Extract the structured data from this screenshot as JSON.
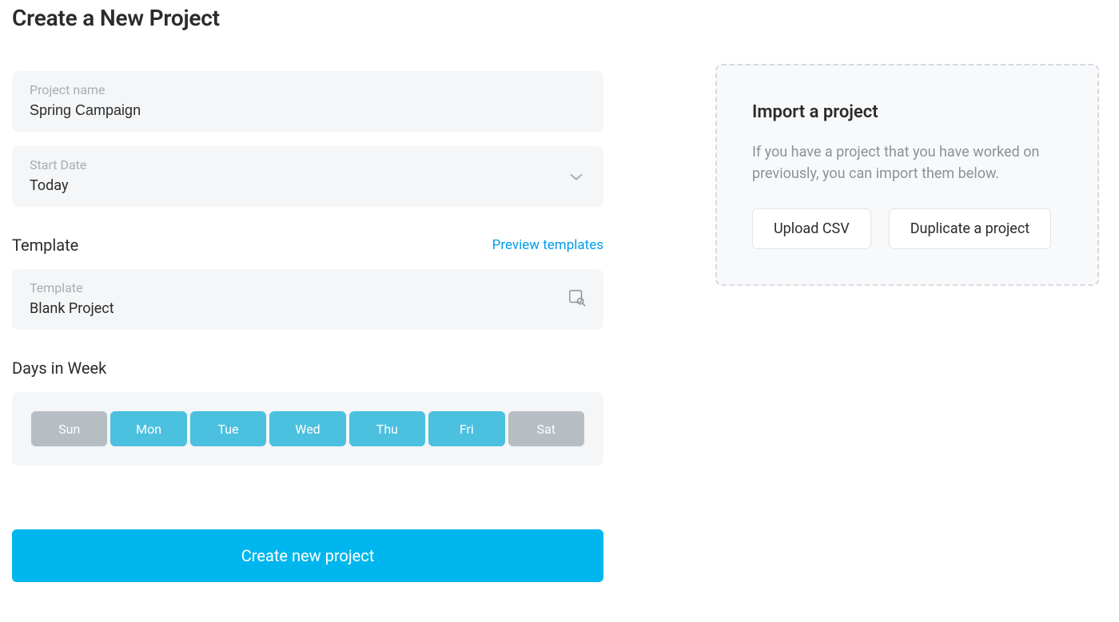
{
  "page": {
    "title": "Create a New Project"
  },
  "form": {
    "projectName": {
      "label": "Project name",
      "value": "Spring Campaign"
    },
    "startDate": {
      "label": "Start Date",
      "value": "Today"
    },
    "template": {
      "sectionTitle": "Template",
      "previewLink": "Preview templates",
      "label": "Template",
      "value": "Blank Project"
    },
    "daysInWeek": {
      "sectionTitle": "Days in Week",
      "days": [
        {
          "label": "Sun",
          "active": false
        },
        {
          "label": "Mon",
          "active": true
        },
        {
          "label": "Tue",
          "active": true
        },
        {
          "label": "Wed",
          "active": true
        },
        {
          "label": "Thu",
          "active": true
        },
        {
          "label": "Fri",
          "active": true
        },
        {
          "label": "Sat",
          "active": false
        }
      ]
    },
    "submitLabel": "Create new project"
  },
  "importPanel": {
    "title": "Import a project",
    "description": "If you have a project that you have worked on previously, you can import them below.",
    "uploadLabel": "Upload CSV",
    "duplicateLabel": "Duplicate a project"
  }
}
